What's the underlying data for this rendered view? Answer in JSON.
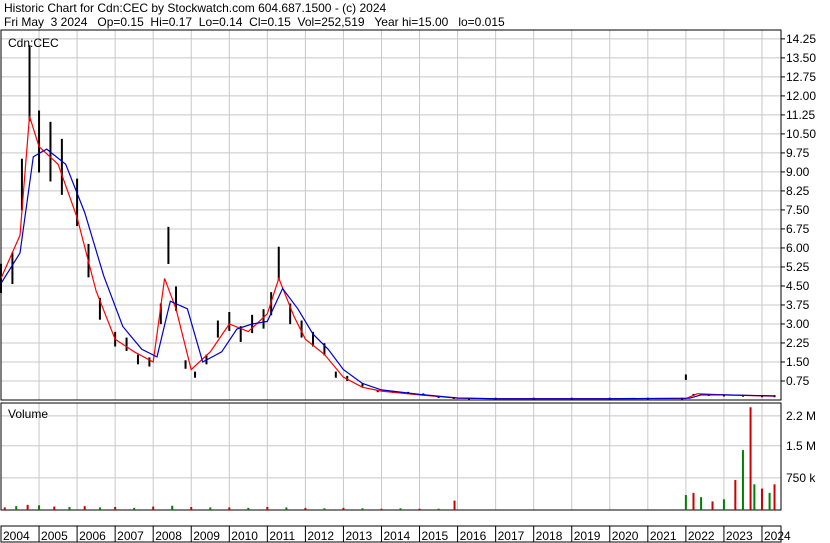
{
  "header": {
    "title_line": "Historic Chart for Cdn:CEC by Stockwatch.com 604.687.1500 - (c) 2024",
    "quote_line": "Fri May  3 2024   Op=0.15  Hi=0.17  Lo=0.14  Cl=0.15  Vol=252,519   Year hi=15.00   lo=0.015"
  },
  "colors": {
    "price_bars": "#000000",
    "ma_short": "#ff0000",
    "ma_mid": "#ff00ff",
    "ma_long": "#0000cc",
    "volume_up": "#008000",
    "volume_down": "#cc0000",
    "grid": "#c8c8c8"
  },
  "chart_data": [
    {
      "type": "line",
      "label": "Cdn:CEC",
      "y_axis": "right",
      "ylim": [
        0,
        14.6
      ],
      "y_ticks": [
        0.75,
        1.5,
        2.25,
        3.0,
        3.75,
        4.5,
        5.25,
        6.0,
        6.75,
        7.5,
        8.25,
        9.0,
        9.75,
        10.5,
        11.25,
        12.0,
        12.75,
        13.5,
        14.25
      ],
      "y_tick_labels": [
        "0.75",
        "1.50",
        "2.25",
        "3.00",
        "3.75",
        "4.50",
        "5.25",
        "6.00",
        "6.75",
        "7.50",
        "8.25",
        "9.00",
        "9.75",
        "10.50",
        "11.25",
        "12.00",
        "12.75",
        "13.50",
        "14.25"
      ],
      "x_tick_labels": [
        "2004",
        "2005",
        "2006",
        "2007",
        "2008",
        "2009",
        "2010",
        "2011",
        "2012",
        "2013",
        "2014",
        "2015",
        "2016",
        "2017",
        "2018",
        "2019",
        "2020",
        "2021",
        "2022",
        "2023",
        "2024"
      ],
      "grid": true,
      "series": [
        {
          "style": "high-low bars",
          "x": [
            2004.0,
            2004.3,
            2004.55,
            2004.75,
            2005.0,
            2005.3,
            2005.6,
            2006.0,
            2006.3,
            2006.6,
            2007.0,
            2007.3,
            2007.6,
            2007.9,
            2008.2,
            2008.4,
            2008.6,
            2008.85,
            2009.1,
            2009.4,
            2009.7,
            2010.0,
            2010.3,
            2010.6,
            2010.9,
            2011.1,
            2011.3,
            2011.6,
            2011.9,
            2012.2,
            2012.5,
            2012.8,
            2013.1,
            2013.5,
            2013.9,
            2014.3,
            2014.7,
            2015.1,
            2015.5,
            2015.9,
            2016.3,
            2017.0,
            2018.0,
            2019.0,
            2020.0,
            2021.0,
            2021.9,
            2022.0,
            2022.2,
            2022.6,
            2023.0,
            2023.5,
            2024.0,
            2024.33
          ],
          "y": [
            4.8,
            5.2,
            8.5,
            12.5,
            10.2,
            9.8,
            9.2,
            7.8,
            5.5,
            3.6,
            2.4,
            2.2,
            1.6,
            1.5,
            3.4,
            6.1,
            4.0,
            1.4,
            1.0,
            1.6,
            2.8,
            3.1,
            2.6,
            3.0,
            3.2,
            3.8,
            5.4,
            3.4,
            2.8,
            2.4,
            2.0,
            1.0,
            0.85,
            0.6,
            0.35,
            0.32,
            0.28,
            0.22,
            0.12,
            0.08,
            0.05,
            0.05,
            0.05,
            0.05,
            0.05,
            0.05,
            0.05,
            0.9,
            0.2,
            0.2,
            0.18,
            0.17,
            0.15,
            0.15
          ]
        },
        {
          "style": "moving average short",
          "x": [
            2004.0,
            2004.5,
            2004.75,
            2005.0,
            2005.5,
            2006.0,
            2006.5,
            2007.0,
            2007.5,
            2008.0,
            2008.3,
            2008.6,
            2009.0,
            2009.5,
            2010.0,
            2010.5,
            2011.0,
            2011.3,
            2011.7,
            2012.0,
            2012.5,
            2013.0,
            2013.5,
            2014.0,
            2015.0,
            2016.0,
            2017.0,
            2020.0,
            2022.0,
            2022.3,
            2023.0,
            2024.33
          ],
          "y": [
            4.8,
            6.5,
            11.2,
            10.0,
            9.3,
            7.2,
            4.3,
            2.4,
            1.9,
            1.5,
            4.8,
            3.6,
            1.2,
            1.9,
            3.0,
            2.7,
            3.4,
            4.8,
            3.3,
            2.4,
            1.8,
            0.9,
            0.5,
            0.35,
            0.2,
            0.07,
            0.05,
            0.05,
            0.06,
            0.25,
            0.2,
            0.15
          ]
        },
        {
          "style": "moving average long",
          "x": [
            2004.0,
            2004.5,
            2004.85,
            2005.2,
            2005.7,
            2006.2,
            2006.7,
            2007.2,
            2007.7,
            2008.1,
            2008.45,
            2008.9,
            2009.3,
            2009.8,
            2010.2,
            2010.6,
            2011.0,
            2011.4,
            2011.8,
            2012.2,
            2012.6,
            2013.0,
            2013.5,
            2014.0,
            2015.0,
            2016.0,
            2017.0,
            2020.0,
            2022.1,
            2022.4,
            2023.0,
            2024.33
          ],
          "y": [
            4.6,
            5.8,
            9.6,
            9.9,
            9.3,
            7.4,
            4.9,
            2.9,
            2.0,
            1.7,
            3.9,
            3.6,
            1.5,
            1.9,
            2.8,
            3.0,
            3.1,
            4.4,
            3.6,
            2.6,
            2.0,
            1.2,
            0.65,
            0.4,
            0.22,
            0.08,
            0.05,
            0.05,
            0.07,
            0.2,
            0.2,
            0.16
          ]
        }
      ]
    },
    {
      "type": "bar",
      "label": "Volume",
      "y_axis": "right",
      "ylim": [
        0,
        2500000
      ],
      "y_ticks": [
        750000,
        1500000,
        2200000
      ],
      "y_tick_labels": [
        "750 k",
        "1.5 M",
        "2.2 M"
      ],
      "series": [
        {
          "name": "volume",
          "x": [
            2004.1,
            2004.4,
            2004.7,
            2005.0,
            2005.4,
            2005.8,
            2006.2,
            2006.6,
            2007.0,
            2007.5,
            2008.0,
            2008.5,
            2009.0,
            2009.5,
            2010.0,
            2010.5,
            2011.0,
            2011.5,
            2012.0,
            2012.5,
            2013.0,
            2013.5,
            2014.0,
            2014.5,
            2015.0,
            2015.5,
            2015.92,
            2022.0,
            2022.2,
            2022.4,
            2022.7,
            2023.0,
            2023.3,
            2023.5,
            2023.7,
            2023.8,
            2024.0,
            2024.2,
            2024.33
          ],
          "values": [
            60000,
            90000,
            120000,
            110000,
            80000,
            70000,
            90000,
            60000,
            70000,
            50000,
            80000,
            100000,
            70000,
            60000,
            60000,
            50000,
            70000,
            60000,
            50000,
            40000,
            50000,
            40000,
            30000,
            40000,
            30000,
            30000,
            220000,
            350000,
            400000,
            300000,
            200000,
            250000,
            700000,
            1400000,
            2400000,
            600000,
            500000,
            400000,
            600000
          ]
        }
      ]
    }
  ]
}
